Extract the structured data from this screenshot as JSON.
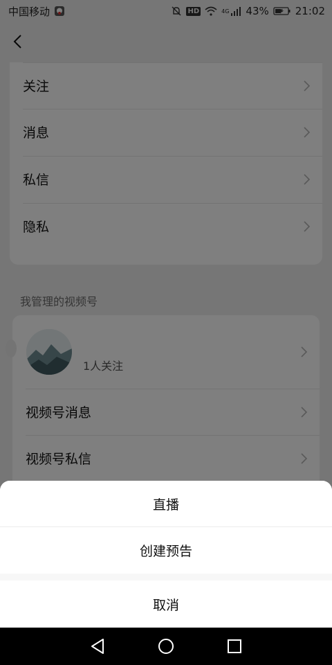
{
  "status_bar": {
    "carrier": "中国移动",
    "network": "4G",
    "hd": "HD",
    "battery": "43%",
    "time": "21:02"
  },
  "nav": {
    "back_icon": "chevron-left-icon"
  },
  "settings_list": {
    "items": [
      {
        "label": "关注"
      },
      {
        "label": "消息"
      },
      {
        "label": "私信"
      },
      {
        "label": "隐私"
      }
    ]
  },
  "channels": {
    "section_title": "我管理的视频号",
    "channel": {
      "followers": "1人关注"
    },
    "items": [
      {
        "label": "视频号消息"
      },
      {
        "label": "视频号私信"
      }
    ]
  },
  "action_sheet": {
    "options": [
      "直播",
      "创建预告"
    ],
    "cancel": "取消"
  },
  "system_nav": [
    "back-triangle-icon",
    "home-circle-icon",
    "recents-square-icon"
  ]
}
